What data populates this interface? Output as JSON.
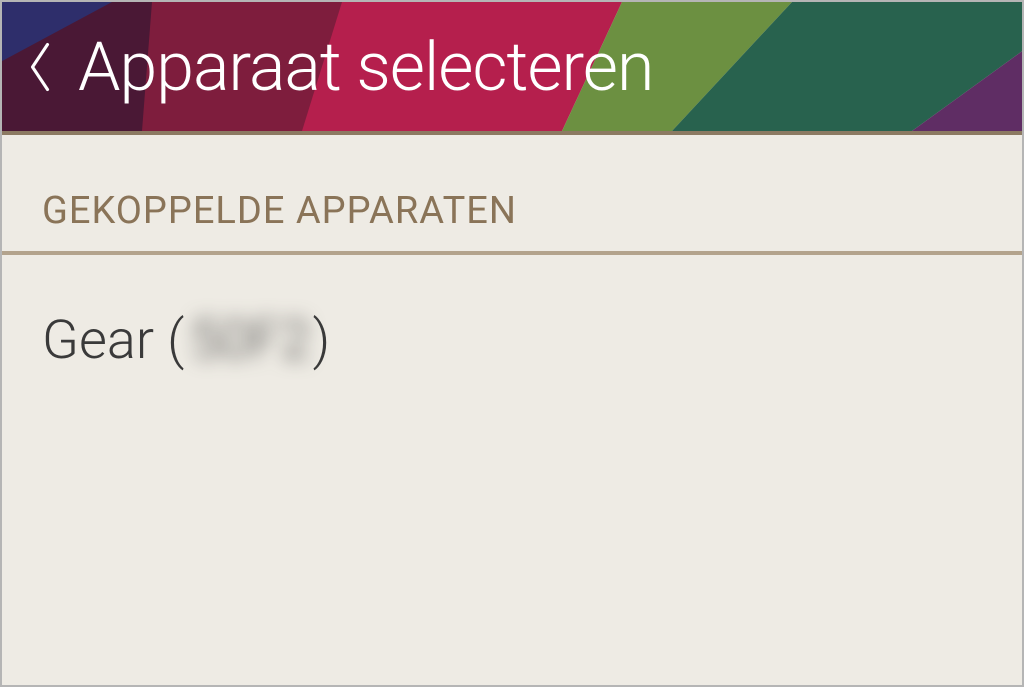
{
  "header": {
    "title": "Apparaat selecteren"
  },
  "section": {
    "title": "GEKOPPELDE APPARATEN"
  },
  "devices": [
    {
      "name_prefix": "Gear (",
      "id_obscured": "50F2",
      "name_suffix": ")"
    }
  ]
}
